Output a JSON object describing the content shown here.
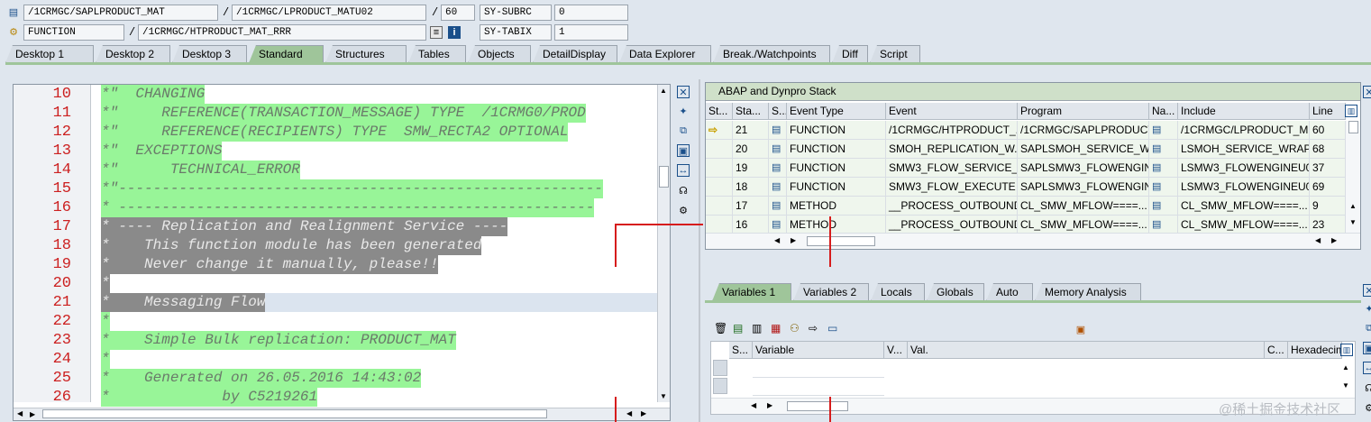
{
  "header": {
    "row1": {
      "field1": "/1CRMGC/SAPLPRODUCT_MAT",
      "sep1": "/",
      "field2": "/1CRMGC/LPRODUCT_MATU02",
      "sep2": "/",
      "field3": "60",
      "var_name": "SY-SUBRC",
      "var_value": "0"
    },
    "row2": {
      "field1": "FUNCTION",
      "sep1": "/",
      "field2": "/1CRMGC/HTPRODUCT_MAT_RRR",
      "var_name": "SY-TABIX",
      "var_value": "1"
    }
  },
  "tabs": [
    "Desktop 1",
    "Desktop 2",
    "Desktop 3",
    "Standard",
    "Structures",
    "Tables",
    "Objects",
    "DetailDisplay",
    "Data Explorer",
    "Break./Watchpoints",
    "Diff",
    "Script"
  ],
  "active_tab": "Standard",
  "editor": {
    "lines": [
      {
        "num": "10",
        "text": "*\"  CHANGING",
        "style": "green"
      },
      {
        "num": "11",
        "text": "*\"     REFERENCE(TRANSACTION_MESSAGE) TYPE  /1CRMG0/PROD",
        "style": "green"
      },
      {
        "num": "12",
        "text": "*\"     REFERENCE(RECIPIENTS) TYPE  SMW_RECTA2 OPTIONAL",
        "style": "green"
      },
      {
        "num": "13",
        "text": "*\"  EXCEPTIONS",
        "style": "green"
      },
      {
        "num": "14",
        "text": "*\"      TECHNICAL_ERROR",
        "style": "green"
      },
      {
        "num": "15",
        "text": "*\"--------------------------------------------------------",
        "style": "green"
      },
      {
        "num": "16",
        "text": "* -------------------------------------------------------",
        "style": "green"
      },
      {
        "num": "17",
        "text": "* ---- Replication and Realignment Service ----",
        "style": "grey"
      },
      {
        "num": "18",
        "text": "*    This function module has been generated",
        "style": "grey"
      },
      {
        "num": "19",
        "text": "*    Never change it manually, please!!",
        "style": "grey"
      },
      {
        "num": "20",
        "text": "*",
        "style": "grey"
      },
      {
        "num": "21",
        "text": "*    Messaging Flow",
        "style": "grey"
      },
      {
        "num": "22",
        "text": "*",
        "style": "green"
      },
      {
        "num": "23",
        "text": "*    Simple Bulk replication: PRODUCT_MAT",
        "style": "green"
      },
      {
        "num": "24",
        "text": "*",
        "style": "green"
      },
      {
        "num": "25",
        "text": "*    Generated on 26.05.2016 14:43:02",
        "style": "green"
      },
      {
        "num": "26",
        "text": "*             by C5219261",
        "style": "green"
      }
    ]
  },
  "stack": {
    "title": "ABAP and Dynpro Stack",
    "columns": [
      "St...",
      "Sta...",
      "S...",
      "Event Type",
      "Event",
      "Program",
      "Na...",
      "Include",
      "Line"
    ],
    "rows": [
      {
        "stack": "21",
        "event_type": "FUNCTION",
        "event": "/1CRMGC/HTPRODUCT_...",
        "program": "/1CRMGC/SAPLPRODUCT...",
        "include": "/1CRMGC/LPRODUCT_M...",
        "line": "60",
        "current": true
      },
      {
        "stack": "20",
        "event_type": "FUNCTION",
        "event": "SMOH_REPLICATION_W...",
        "program": "SAPLSMOH_SERVICE_W...",
        "include": "LSMOH_SERVICE_WRAP...",
        "line": "68",
        "current": false
      },
      {
        "stack": "19",
        "event_type": "FUNCTION",
        "event": "SMW3_FLOW_SERVICE_...",
        "program": "SAPLSMW3_FLOWENGIN...",
        "include": "LSMW3_FLOWENGINEU0...",
        "line": "37",
        "current": false
      },
      {
        "stack": "18",
        "event_type": "FUNCTION",
        "event": "SMW3_FLOW_EXECUTE",
        "program": "SAPLSMW3_FLOWENGIN...",
        "include": "LSMW3_FLOWENGINEU0...",
        "line": "69",
        "current": false
      },
      {
        "stack": "17",
        "event_type": "METHOD",
        "event": "__PROCESS_OUTBOUND",
        "program": "CL_SMW_MFLOW====...",
        "include": "CL_SMW_MFLOW====...",
        "line": "9",
        "current": false
      },
      {
        "stack": "16",
        "event_type": "METHOD",
        "event": "__PROCESS_OUTBOUND",
        "program": "CL_SMW_MFLOW====...",
        "include": "CL_SMW_MFLOW====...",
        "line": "23",
        "current": false
      }
    ]
  },
  "vars": {
    "tabs": [
      "Variables 1",
      "Variables 2",
      "Locals",
      "Globals",
      "Auto",
      "Memory Analysis"
    ],
    "active_tab": "Variables 1",
    "columns": [
      "S...",
      "Variable",
      "V...",
      "Val.",
      "C...",
      "Hexadecim"
    ]
  },
  "watermark": "@稀土掘金技术社区"
}
